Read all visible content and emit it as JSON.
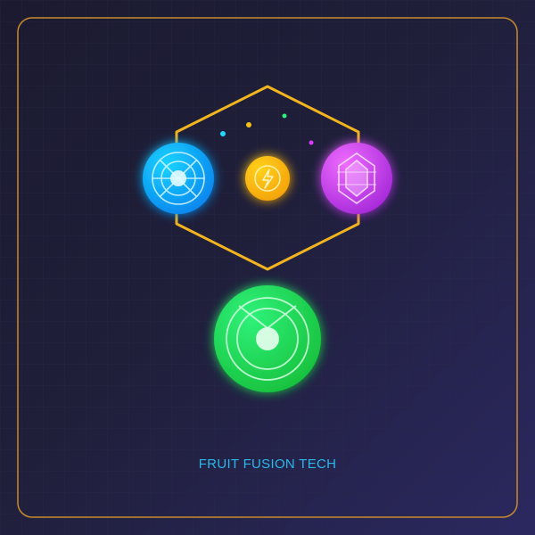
{
  "tagline": "FRUIT FUSION TECH",
  "colors": {
    "frame": "#c98a2e",
    "hexagon": "#f2b41f",
    "grid": "#2a2a4a",
    "tagline": "#2bb8e8",
    "blue_orb": [
      "#18d4ff",
      "#0a86ee"
    ],
    "yellow_orb": [
      "#ffd21a",
      "#f4a30c"
    ],
    "purple_orb": [
      "#f06cff",
      "#a62ad9"
    ],
    "green_orb": [
      "#2ff27a",
      "#18c23e"
    ],
    "particles": [
      "#22d8ff",
      "#f4c21a",
      "#2cf07c",
      "#d93cff"
    ]
  },
  "icons": [
    "orb-blue-icon",
    "lightning-bolt-icon",
    "crystal-gem-icon",
    "orb-green-icon"
  ]
}
